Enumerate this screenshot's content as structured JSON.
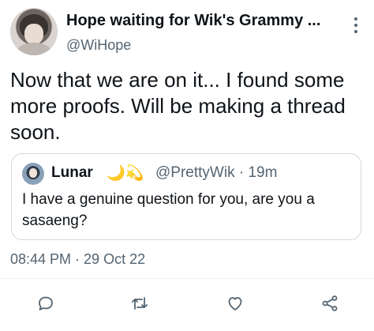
{
  "tweet": {
    "author": {
      "display_name": "Hope waiting for Wik's Grammy ...",
      "handle": "@WiHope"
    },
    "text": "Now that we are on it... I found some more proofs. Will be making a thread soon.",
    "timestamp": "08:44 PM · 29 Oct 22"
  },
  "quote": {
    "display_name": "Lunar",
    "emoji": "🌙💫",
    "handle_time": "@PrettyWik · 19m",
    "text": "I have a genuine question for you, are you a sasaeng?"
  },
  "icons": {
    "more": "more-vertical-icon",
    "reply": "reply-icon",
    "retweet": "retweet-icon",
    "like": "heart-icon",
    "share": "share-icon"
  },
  "colors": {
    "text_primary": "#0f1419",
    "text_secondary": "#536471",
    "border": "#cfd9de"
  }
}
